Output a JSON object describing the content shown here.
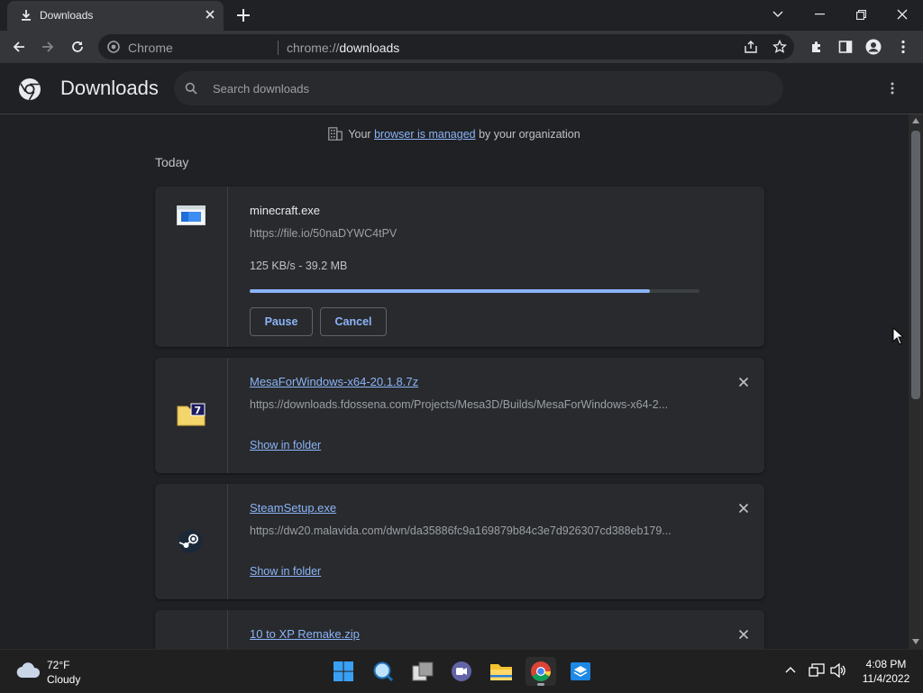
{
  "tab": {
    "title": "Downloads"
  },
  "toolbar": {
    "omnibox_label": "Chrome",
    "url_scheme": "chrome://",
    "url_path": "downloads"
  },
  "downloads_page": {
    "title": "Downloads",
    "search_placeholder": "Search downloads",
    "managed_prefix": "Your",
    "managed_link": "browser is managed",
    "managed_suffix": "by your organization",
    "section_label": "Today",
    "items": [
      {
        "filename": "minecraft.exe",
        "url": "https://file.io/50naDYWC4tPV",
        "status": "125 KB/s - 39.2 MB",
        "progress_percent": 89,
        "pause_label": "Pause",
        "cancel_label": "Cancel",
        "icon": "exe-window-icon"
      },
      {
        "filename": "MesaForWindows-x64-20.1.8.7z",
        "url": "https://downloads.fdossena.com/Projects/Mesa3D/Builds/MesaForWindows-x64-2...",
        "show_in_folder": "Show in folder",
        "icon": "7zip-archive-icon"
      },
      {
        "filename": "SteamSetup.exe",
        "url": "https://dw20.malavida.com/dwn/da35886fc9a169879b84c3e7d926307cd388eb179...",
        "show_in_folder": "Show in folder",
        "icon": "steam-icon"
      },
      {
        "filename": "10 to XP Remake.zip",
        "icon": "zip-icon"
      }
    ]
  },
  "taskbar": {
    "weather_temp": "72°F",
    "weather_condition": "Cloudy",
    "time": "4:08 PM",
    "date": "11/4/2022"
  },
  "colors": {
    "accent": "#8ab4f8",
    "background": "#202124",
    "card": "#292a2d"
  }
}
